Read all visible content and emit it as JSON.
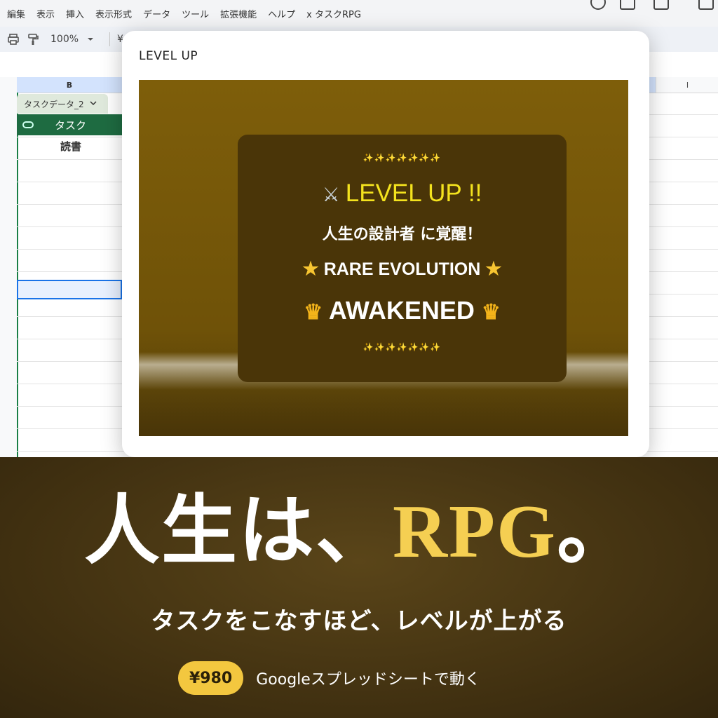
{
  "menubar": {
    "items": [
      "編集",
      "表示",
      "挿入",
      "表示形式",
      "データ",
      "ツール",
      "拡張機能",
      "ヘルプ",
      "x タスクRPG"
    ]
  },
  "toolbar": {
    "zoom": "100%",
    "currency_symbol": "¥",
    "icons": [
      "print-icon",
      "paint-format-icon",
      "dropdown-caret-icon",
      "more-vert-icon"
    ]
  },
  "sheet": {
    "column_b": "B",
    "column_i": "I",
    "table_tab": "タスクデータ_2",
    "table_header": "タスク",
    "cell_value": "読書"
  },
  "dialog": {
    "title": "LEVEL UP",
    "sparkles": "✨✨✨✨✨✨✨",
    "level_up": "LEVEL UP !!",
    "awakening": "人生の設計者 に覚醒！",
    "rare_evolution": "RARE EVOLUTION",
    "awakened": "AWAKENED",
    "icons": [
      "crossed-swords-icon",
      "glowing-star-icon",
      "crown-icon"
    ]
  },
  "hero": {
    "title_main": "人生は、",
    "title_accent": "RPG",
    "title_end": "。",
    "subtitle": "タスクをこなすほど、レベルが上がる",
    "price": "¥980",
    "note": "Googleスプレッドシートで動く"
  },
  "colors": {
    "accent_gold": "#f5cf52",
    "stage_brown": "#7e5e0a",
    "card_dark": "#4a3508",
    "level_yellow": "#f4e31e",
    "sheet_green": "#1e6b41"
  }
}
